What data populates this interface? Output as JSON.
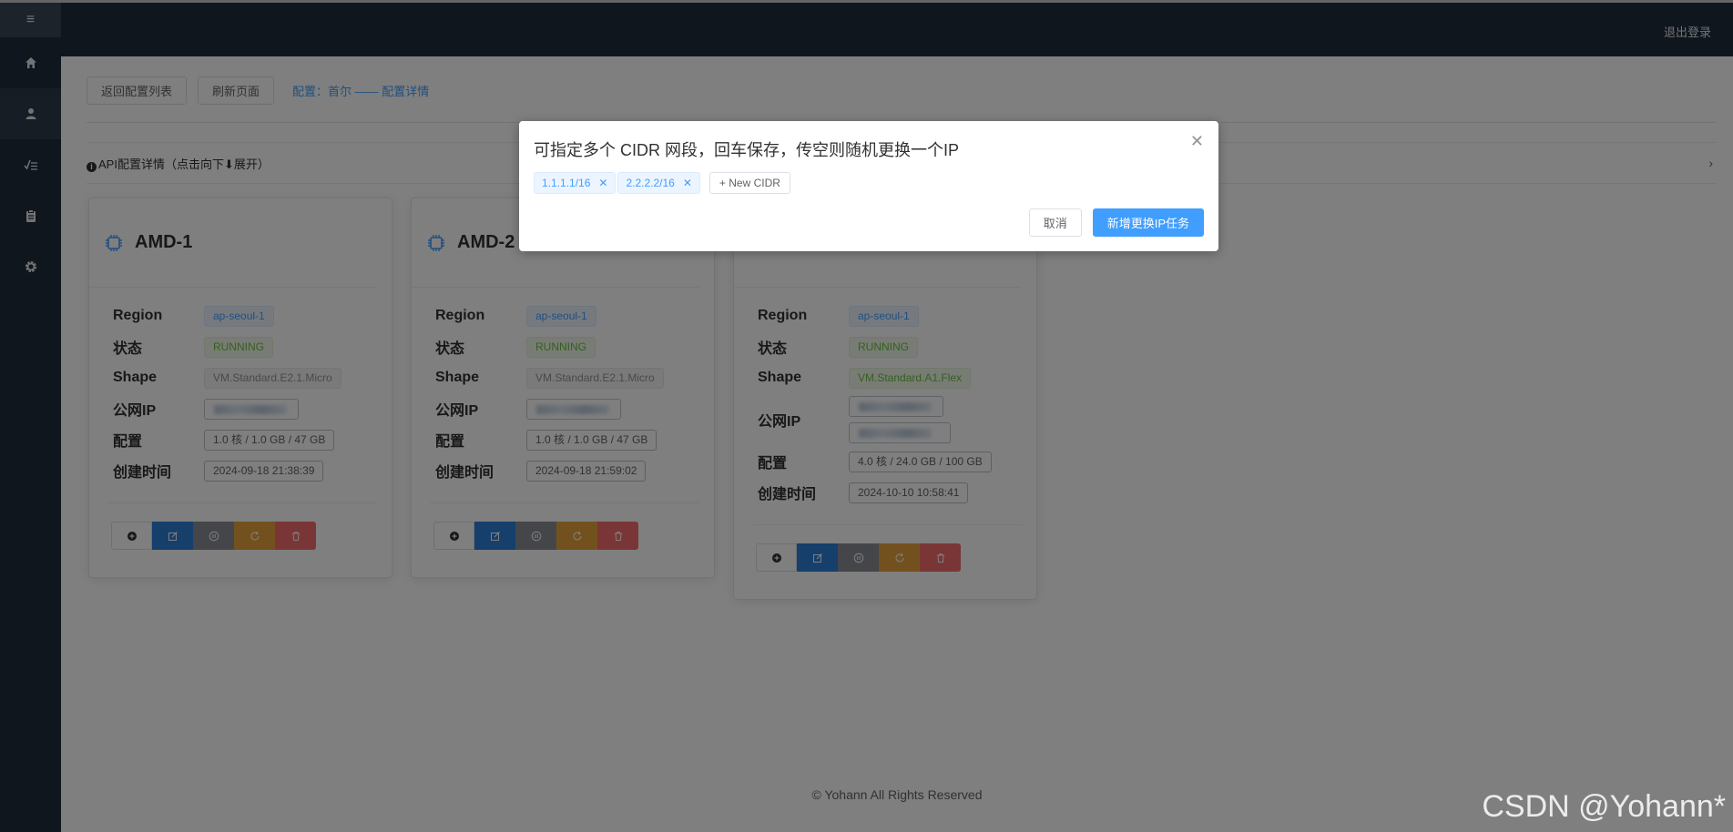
{
  "header": {
    "logout": "退出登录"
  },
  "toolbar": {
    "back": "返回配置列表",
    "refresh": "刷新页面",
    "breadcrumb": "配置：首尔 —— 配置详情"
  },
  "collapse": {
    "title": "API配置详情（点击向下⬇展开）"
  },
  "labels": {
    "region": "Region",
    "status": "状态",
    "shape": "Shape",
    "ip": "公网IP",
    "config": "配置",
    "created": "创建时间"
  },
  "cards": [
    {
      "name": "AMD-1",
      "region": "ap-seoul-1",
      "status": "RUNNING",
      "shape": "VM.Standard.E2.1.Micro",
      "config": "1.0 核 / 1.0 GB / 47 GB",
      "created": "2024-09-18 21:38:39"
    },
    {
      "name": "AMD-2",
      "region": "ap-seoul-1",
      "status": "RUNNING",
      "shape": "VM.Standard.E2.1.Micro",
      "config": "1.0 核 / 1.0 GB / 47 GB",
      "created": "2024-09-18 21:59:02"
    },
    {
      "name": "",
      "region": "ap-seoul-1",
      "status": "RUNNING",
      "shape": "VM.Standard.A1.Flex",
      "config": "4.0 核 / 24.0 GB / 100 GB",
      "created": "2024-10-10 10:58:41"
    }
  ],
  "dialog": {
    "title": "可指定多个 CIDR 网段，回车保存，传空则随机更换一个IP",
    "cidrs": [
      "1.1.1.1/16",
      "2.2.2.2/16"
    ],
    "new_cidr": "+ New CIDR",
    "cancel": "取消",
    "confirm": "新增更换IP任务"
  },
  "footer": "© Yohann All Rights Reserved",
  "watermark": "CSDN @Yohann*",
  "colors": {
    "sidebar": "#1f2d3d",
    "primary": "#409eff",
    "success": "#67c23a",
    "warning": "#e6a23c",
    "danger": "#f56c6c"
  },
  "icons": {
    "sidebar": [
      "menu-icon",
      "home-icon",
      "user-icon",
      "chart-icon",
      "clipboard-icon",
      "gear-icon"
    ],
    "actions": [
      "plus-icon",
      "edit-icon",
      "pause-icon",
      "refresh-icon",
      "delete-icon"
    ]
  }
}
